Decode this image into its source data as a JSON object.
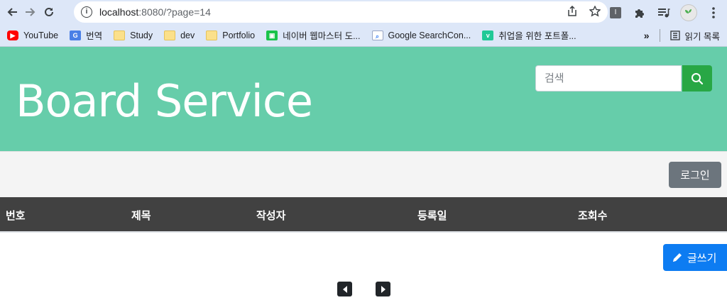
{
  "browser": {
    "url_host": "localhost",
    "url_rest": ":8080/?page=14",
    "bookmarks": [
      {
        "label": "YouTube",
        "icon": "youtube-icon"
      },
      {
        "label": "번역",
        "icon": "translate-icon"
      },
      {
        "label": "Study",
        "icon": "folder-icon"
      },
      {
        "label": "dev",
        "icon": "folder-icon"
      },
      {
        "label": "Portfolio",
        "icon": "folder-icon"
      },
      {
        "label": "네이버 웹마스터 도...",
        "icon": "naver-icon"
      },
      {
        "label": "Google SearchCon...",
        "icon": "google-search-console-icon"
      },
      {
        "label": "취업을 위한 포트폴...",
        "icon": "vimeo-icon"
      }
    ],
    "more": "»",
    "reading_list": "읽기 목록",
    "ext_letter": "I"
  },
  "header": {
    "title": "Board Service",
    "search_placeholder": "검색"
  },
  "toolbar": {
    "login_label": "로그인"
  },
  "table": {
    "columns": [
      "번호",
      "제목",
      "작성자",
      "등록일",
      "조회수"
    ]
  },
  "actions": {
    "write_label": "글쓰기"
  },
  "colors": {
    "hero": "#66cdaa",
    "search_button": "#28a745",
    "login_button": "#6c757d",
    "table_header": "#414141",
    "write_button": "#0d7cf2"
  }
}
